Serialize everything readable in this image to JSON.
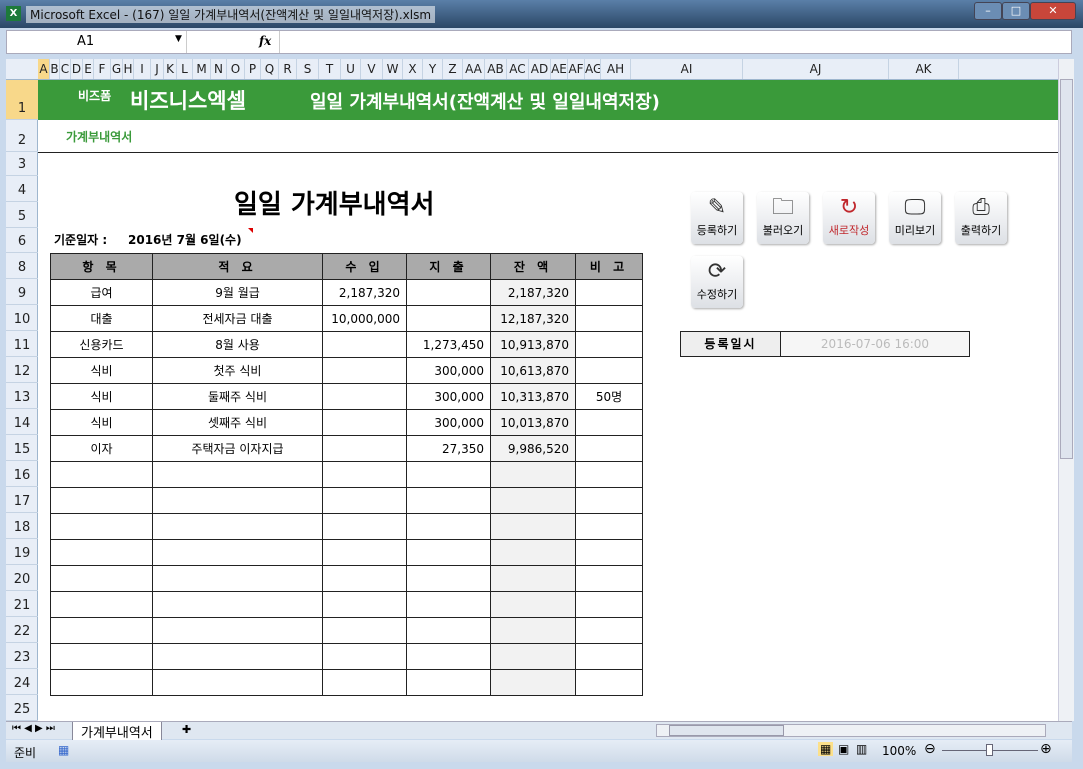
{
  "window": {
    "title": "Microsoft Excel - (167) 일일 가계부내역서(잔액계산 및 일일내역저장).xlsm",
    "app_icon": "X"
  },
  "formula_bar": {
    "name_box": "A1",
    "fx": "fx",
    "formula": ""
  },
  "columns": [
    "A",
    "B",
    "C",
    "D",
    "E",
    "F",
    "G",
    "H",
    "I",
    "J",
    "K",
    "L",
    "M",
    "N",
    "O",
    "P",
    "Q",
    "R",
    "S",
    "T",
    "U",
    "V",
    "W",
    "X",
    "Y",
    "Z",
    "AA",
    "AB",
    "AC",
    "AD",
    "AE",
    "AF",
    "AG",
    "AH",
    "AI",
    "AJ",
    "AK"
  ],
  "rows": [
    "1",
    "2",
    "3",
    "4",
    "5",
    "6",
    "8",
    "9",
    "10",
    "11",
    "12",
    "13",
    "14",
    "15",
    "16",
    "17",
    "18",
    "19",
    "20",
    "21",
    "22",
    "23",
    "24",
    "25"
  ],
  "banner": {
    "brand_small": "비즈폼",
    "brand": "비즈니스엑셀",
    "title": "일일 가계부내역서(잔액계산 및 일일내역저장)"
  },
  "subtitle": "가계부내역서",
  "doc_title": "일일 가계부내역서",
  "base_date_label": "기준일자 :",
  "base_date": "2016년 7월 6일(수)",
  "table": {
    "headers": [
      "항 목",
      "적 요",
      "수 입",
      "지 출",
      "잔 액",
      "비 고"
    ],
    "rows": [
      [
        "급여",
        "9월 월급",
        "2,187,320",
        "",
        "2,187,320",
        ""
      ],
      [
        "대출",
        "전세자금 대출",
        "10,000,000",
        "",
        "12,187,320",
        ""
      ],
      [
        "신용카드",
        "8월 사용",
        "",
        "1,273,450",
        "10,913,870",
        ""
      ],
      [
        "식비",
        "첫주 식비",
        "",
        "300,000",
        "10,613,870",
        ""
      ],
      [
        "식비",
        "둘째주 식비",
        "",
        "300,000",
        "10,313,870",
        "50명"
      ],
      [
        "식비",
        "셋째주 식비",
        "",
        "300,000",
        "10,013,870",
        ""
      ],
      [
        "이자",
        "주택자금 이자지급",
        "",
        "27,350",
        "9,986,520",
        ""
      ],
      [
        "",
        "",
        "",
        "",
        "",
        ""
      ],
      [
        "",
        "",
        "",
        "",
        "",
        ""
      ],
      [
        "",
        "",
        "",
        "",
        "",
        ""
      ],
      [
        "",
        "",
        "",
        "",
        "",
        ""
      ],
      [
        "",
        "",
        "",
        "",
        "",
        ""
      ],
      [
        "",
        "",
        "",
        "",
        "",
        ""
      ],
      [
        "",
        "",
        "",
        "",
        "",
        ""
      ],
      [
        "",
        "",
        "",
        "",
        "",
        ""
      ],
      [
        "",
        "",
        "",
        "",
        "",
        ""
      ]
    ]
  },
  "buttons": [
    {
      "label": "등록하기",
      "icon": "pencil-icon",
      "glyph": "✎"
    },
    {
      "label": "불러오기",
      "icon": "folder-download-icon",
      "glyph": "🗀"
    },
    {
      "label": "새로작성",
      "icon": "refresh-circle-icon",
      "glyph": "↻"
    },
    {
      "label": "미리보기",
      "icon": "monitor-icon",
      "glyph": "🖵"
    },
    {
      "label": "출력하기",
      "icon": "printer-icon",
      "glyph": "⎙"
    },
    {
      "label": "수정하기",
      "icon": "sync-icon",
      "glyph": "⟳"
    }
  ],
  "reg": {
    "label": "등록일시",
    "value": "2016-07-06 16:00"
  },
  "sheet_tab": "가계부내역서",
  "status": {
    "ready": "준비",
    "zoom": "100%"
  },
  "colors": {
    "banner": "#3a9a3a",
    "accent_red": "#c0282d"
  }
}
